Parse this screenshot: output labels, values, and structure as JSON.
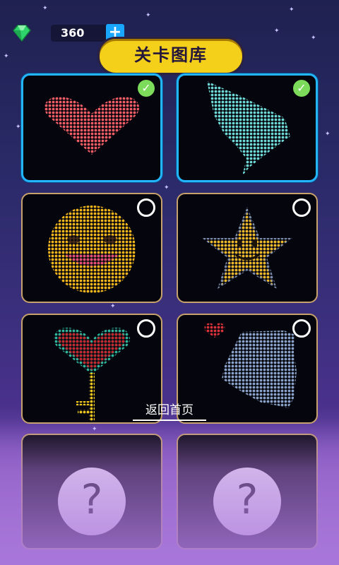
{
  "header": {
    "gem_icon": "green-gem-icon",
    "gem_count": "360",
    "add_label": "+",
    "title": "关卡图库"
  },
  "levels": [
    {
      "name": "heart",
      "status": "completed",
      "status_icon": "check-icon",
      "pixel_color": "#f45c66"
    },
    {
      "name": "wing",
      "status": "completed",
      "status_icon": "check-icon",
      "pixel_color": "#6ed8d6"
    },
    {
      "name": "smiley",
      "status": "unlocked",
      "status_icon": "empty-circle-icon",
      "pixel_color": "#f2b51c"
    },
    {
      "name": "star",
      "status": "unlocked",
      "status_icon": "empty-circle-icon",
      "pixel_color": "#f0b726"
    },
    {
      "name": "key-heart",
      "status": "unlocked",
      "status_icon": "empty-circle-icon",
      "pixel_color": "#c4272e"
    },
    {
      "name": "silhouette",
      "status": "unlocked",
      "status_icon": "empty-circle-icon",
      "pixel_color": "#8aa2c8"
    },
    {
      "name": "locked-1",
      "status": "locked",
      "label": "?"
    },
    {
      "name": "locked-2",
      "status": "locked",
      "label": "?"
    }
  ],
  "footer": {
    "back_label": "返回首页"
  },
  "colors": {
    "title_bg": "#f4d01b",
    "completed_border": "#22b6ff",
    "open_border": "#c7a26c",
    "check_bg": "#7cdb5a",
    "plus_bg": "#19a6ff"
  }
}
